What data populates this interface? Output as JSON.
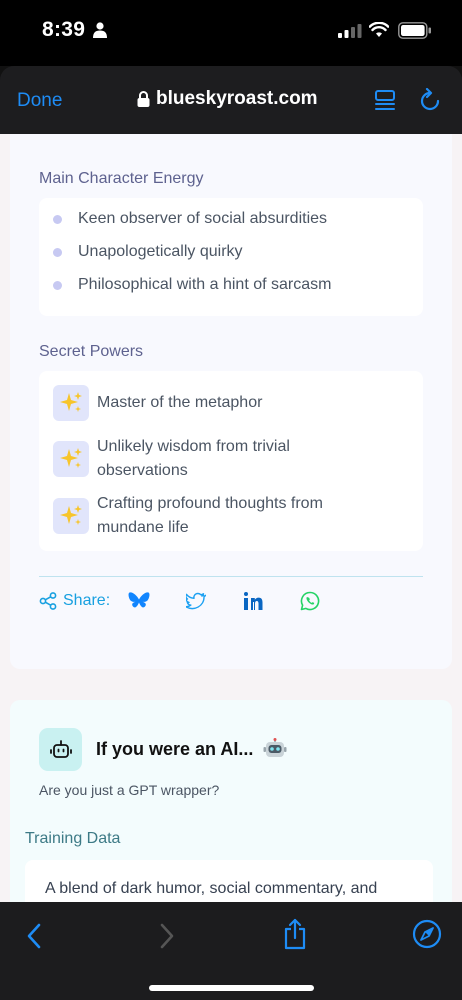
{
  "status_bar": {
    "time": "8:39"
  },
  "browser": {
    "done_label": "Done",
    "url": "blueskyroast.com"
  },
  "main_character": {
    "title": "Main Character Energy",
    "items": [
      "Keen observer of social absurdities",
      "Unapologetically quirky",
      "Philosophical with a hint of sarcasm"
    ]
  },
  "secret_powers": {
    "title": "Secret Powers",
    "items": [
      {
        "line1": "Master of the metaphor",
        "line2": ""
      },
      {
        "line1": "Unlikely wisdom from trivial",
        "line2": "observations"
      },
      {
        "line1": "Crafting profound thoughts from",
        "line2": "mundane life"
      }
    ]
  },
  "share": {
    "label": "Share:",
    "networks": [
      "bluesky",
      "twitter",
      "linkedin",
      "whatsapp"
    ]
  },
  "ai_card": {
    "title": "If you were an AI...",
    "subtitle": "Are you just a GPT wrapper?",
    "training_title": "Training Data",
    "training_text": "A blend of dark humor, social commentary, and"
  },
  "colors": {
    "accent_blue": "#1e8cf5",
    "section_title": "#5e628f",
    "share_blue": "#18a0e0",
    "bluesky": "#1185fe",
    "twitter": "#1da1f2",
    "linkedin": "#0a66c2",
    "whatsapp": "#25d366"
  },
  "icons": [
    "person-icon",
    "signal-icon",
    "wifi-icon",
    "battery-icon",
    "lock-icon",
    "reader-icon",
    "reload-icon",
    "sparkle-icon",
    "share-icon",
    "robot-icon",
    "back-icon",
    "forward-icon",
    "share-sheet-icon",
    "compass-icon"
  ]
}
